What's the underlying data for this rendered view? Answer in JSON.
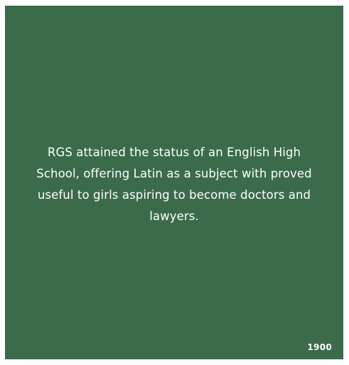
{
  "card": {
    "text": "RGS attained the status of an English High School, offering Latin as a subject with proved useful to girls aspiring to become doctors and lawyers.",
    "year": "1900",
    "background_color": "#3b6b4b",
    "text_color": "#ffffff"
  }
}
